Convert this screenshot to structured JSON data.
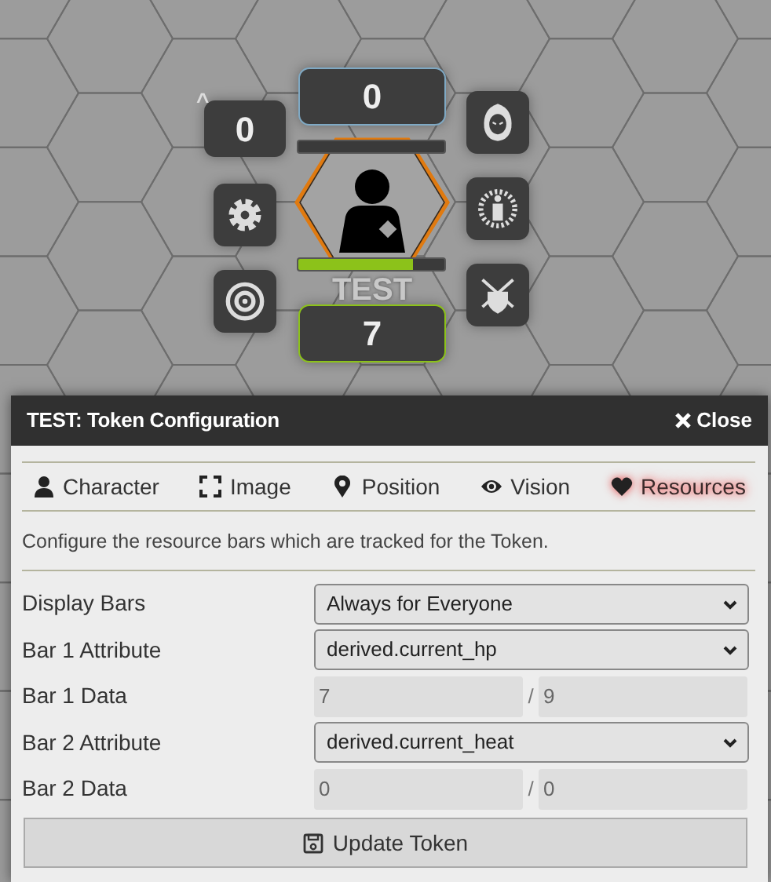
{
  "token": {
    "name": "TEST",
    "bubbles": [
      {
        "value": "0",
        "color": "#7fa9c4"
      },
      {
        "value": "7",
        "color": "#8cc21a"
      }
    ],
    "side_bubble": {
      "value": "0",
      "caret": "^"
    },
    "bar": {
      "level": 0.78,
      "color": "#8cc21a"
    }
  },
  "dialog": {
    "title": "TEST: Token Configuration",
    "close": "Close",
    "tabs": [
      {
        "label": "Character",
        "selected": false
      },
      {
        "label": "Image",
        "selected": false
      },
      {
        "label": "Position",
        "selected": false
      },
      {
        "label": "Vision",
        "selected": false
      },
      {
        "label": "Resources",
        "selected": true
      }
    ],
    "description": "Configure the resource bars which are tracked for the Token.",
    "rows": [
      {
        "kind": "select",
        "label": "Display Bars",
        "value": "Always for Everyone"
      },
      {
        "kind": "select",
        "label": "Bar 1 Attribute",
        "value": "derived.current_hp"
      },
      {
        "kind": "pair",
        "label": "Bar 1 Data",
        "value": "7",
        "separator": "/",
        "max": "9"
      },
      {
        "kind": "select",
        "label": "Bar 2 Attribute",
        "value": "derived.current_heat"
      },
      {
        "kind": "pair",
        "label": "Bar 2 Data",
        "value": "0",
        "separator": "/",
        "max": "0"
      }
    ],
    "button": "Update Token"
  }
}
